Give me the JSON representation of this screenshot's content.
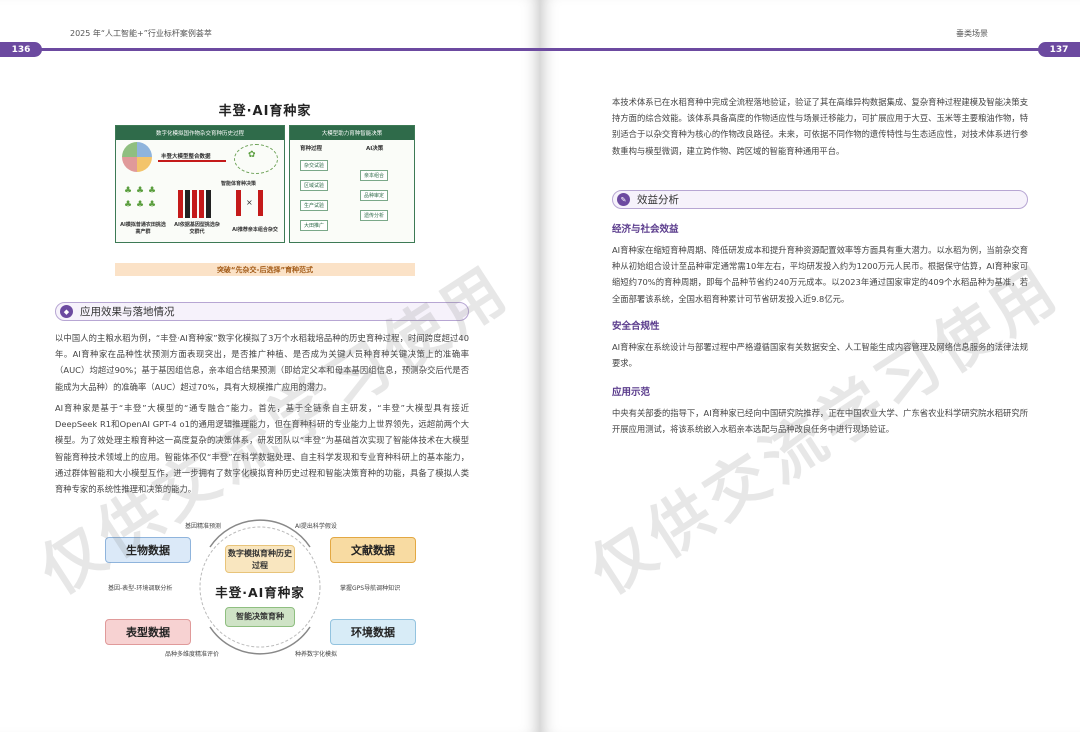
{
  "header": {
    "left_title": "2025 年“人工智能+”行业标杆案例荟萃",
    "left_page": "136",
    "right_title": "垂类场景",
    "right_page": "137"
  },
  "figure1": {
    "title": "丰登·AI育种家",
    "left_panel_title": "数字化模拟国作物杂交育种历史过程",
    "right_panel_title": "大模型助力育种智能决策",
    "core_label": "丰登大模型整合数据",
    "decision_label": "智能体育种决策",
    "caption_a": "AI模拟普通农田挑选高产群",
    "caption_b": "AI依据基因型挑选杂交群代",
    "caption_c": "AI推荐亲本组合杂交",
    "process_title": "育种过程",
    "process_steps": [
      "杂交试验",
      "区域试验",
      "生产试验",
      "大田推广"
    ],
    "ai_title": "AI决策",
    "ai_steps": [
      "亲本组合",
      "品种审定",
      "遗传分析"
    ],
    "bottom_banner": "突破“先杂交-后选择”育种范式"
  },
  "section1": {
    "title": "应用效果与落地情况",
    "para1": "以中国人的主粮水稻为例，“丰登·AI育种家”数字化模拟了3万个水稻栽培品种的历史育种过程，时间跨度超过40年。AI育种家在品种性状预测方面表现突出，是否推广种植、是否成为关键人员种育种关键决策上的准确率（AUC）均超过90%；基于基因组信息，亲本组合结果预测（即给定父本和母本基因组信息，预测杂交后代是否能成为大品种）的准确率（AUC）超过70%，具有大规模推广应用的潜力。",
    "para2": "AI育种家是基于“丰登”大模型的“通专融合”能力。首先，基于全链条自主研发，“丰登”大模型具有接近DeepSeek R1和OpenAI GPT-4 o1的通用逻辑推理能力，但在育种科研的专业能力上世界领先，远超前两个大模型。为了效处理主粮育种这一高度复杂的决策体系，研发团队以“丰登”为基础首次实现了智能体技术在大模型智能育种技术领域上的应用。智能体不仅“丰登”在科学数据处理、自主科学发现和专业育种科研上的基本能力，通过群体智能和大小模型互作，进一步拥有了数字化模拟育种历史过程和智能决策育种的功能，具备了模拟人类育种专家的系统性推理和决策的能力。"
  },
  "figure2": {
    "bio": "生物数据",
    "lit": "文献数据",
    "phe": "表型数据",
    "env": "环境数据",
    "cap_tl": "基因精准预测",
    "cap_tr": "AI提出科学假设",
    "cap_ml": "基因-表型-环境调联分析",
    "cap_mr": "掌握GPS导航调种知识",
    "cap_bl": "品种多维度精准评价",
    "cap_br": "种养数字化模拟",
    "center_top": "数字模拟育种历史过程",
    "center_main": "丰登·AI育种家",
    "center_bot": "智能决策育种"
  },
  "right": {
    "intro": "本技术体系已在水稻育种中完成全流程落地验证，验证了其在高维异构数据集成、复杂育种过程建模及智能决策支持方面的综合效能。该体系具备高度的作物适应性与场景迁移能力，可扩展应用于大豆、玉米等主要粮油作物，特别适合于以杂交育种为核心的作物改良路径。未来，可依据不同作物的遗传特性与生态适应性，对技术体系进行参数重构与模型微调，建立跨作物、跨区域的智能育种通用平台。",
    "section_title": "效益分析",
    "sub1": "经济与社会效益",
    "p1": "AI育种家在缩短育种周期、降低研发成本和提升育种资源配置效率等方面具有重大潜力。以水稻为例，当前杂交育种从初始组合设计至品种审定通常需10年左右，平均研发投入约为1200万元人民币。根据保守估算，AI育种家可缩短约70%的育种周期，即每个品种节省约240万元成本。以2023年通过国家审定的409个水稻品种为基准，若全面部署该系统，全国水稻育种累计可节省研发投入近9.8亿元。",
    "sub2": "安全合规性",
    "p2": "AI育种家在系统设计与部署过程中严格遵循国家有关数据安全、人工智能生成内容管理及网络信息服务的法律法规要求。",
    "sub3": "应用示范",
    "p3": "中央有关部委的指导下，AI育种家已经向中国研究院推荐，正在中国农业大学、广东省农业科学研究院水稻研究所开展应用测试，将该系统嵌入水稻亲本选配与品种改良任务中进行现场验证。"
  },
  "watermark": "仅供交流学习使用",
  "colors": {
    "accent": "#6c4aa0",
    "green": "#2f6b4a",
    "banner": "#fbe2c7"
  }
}
